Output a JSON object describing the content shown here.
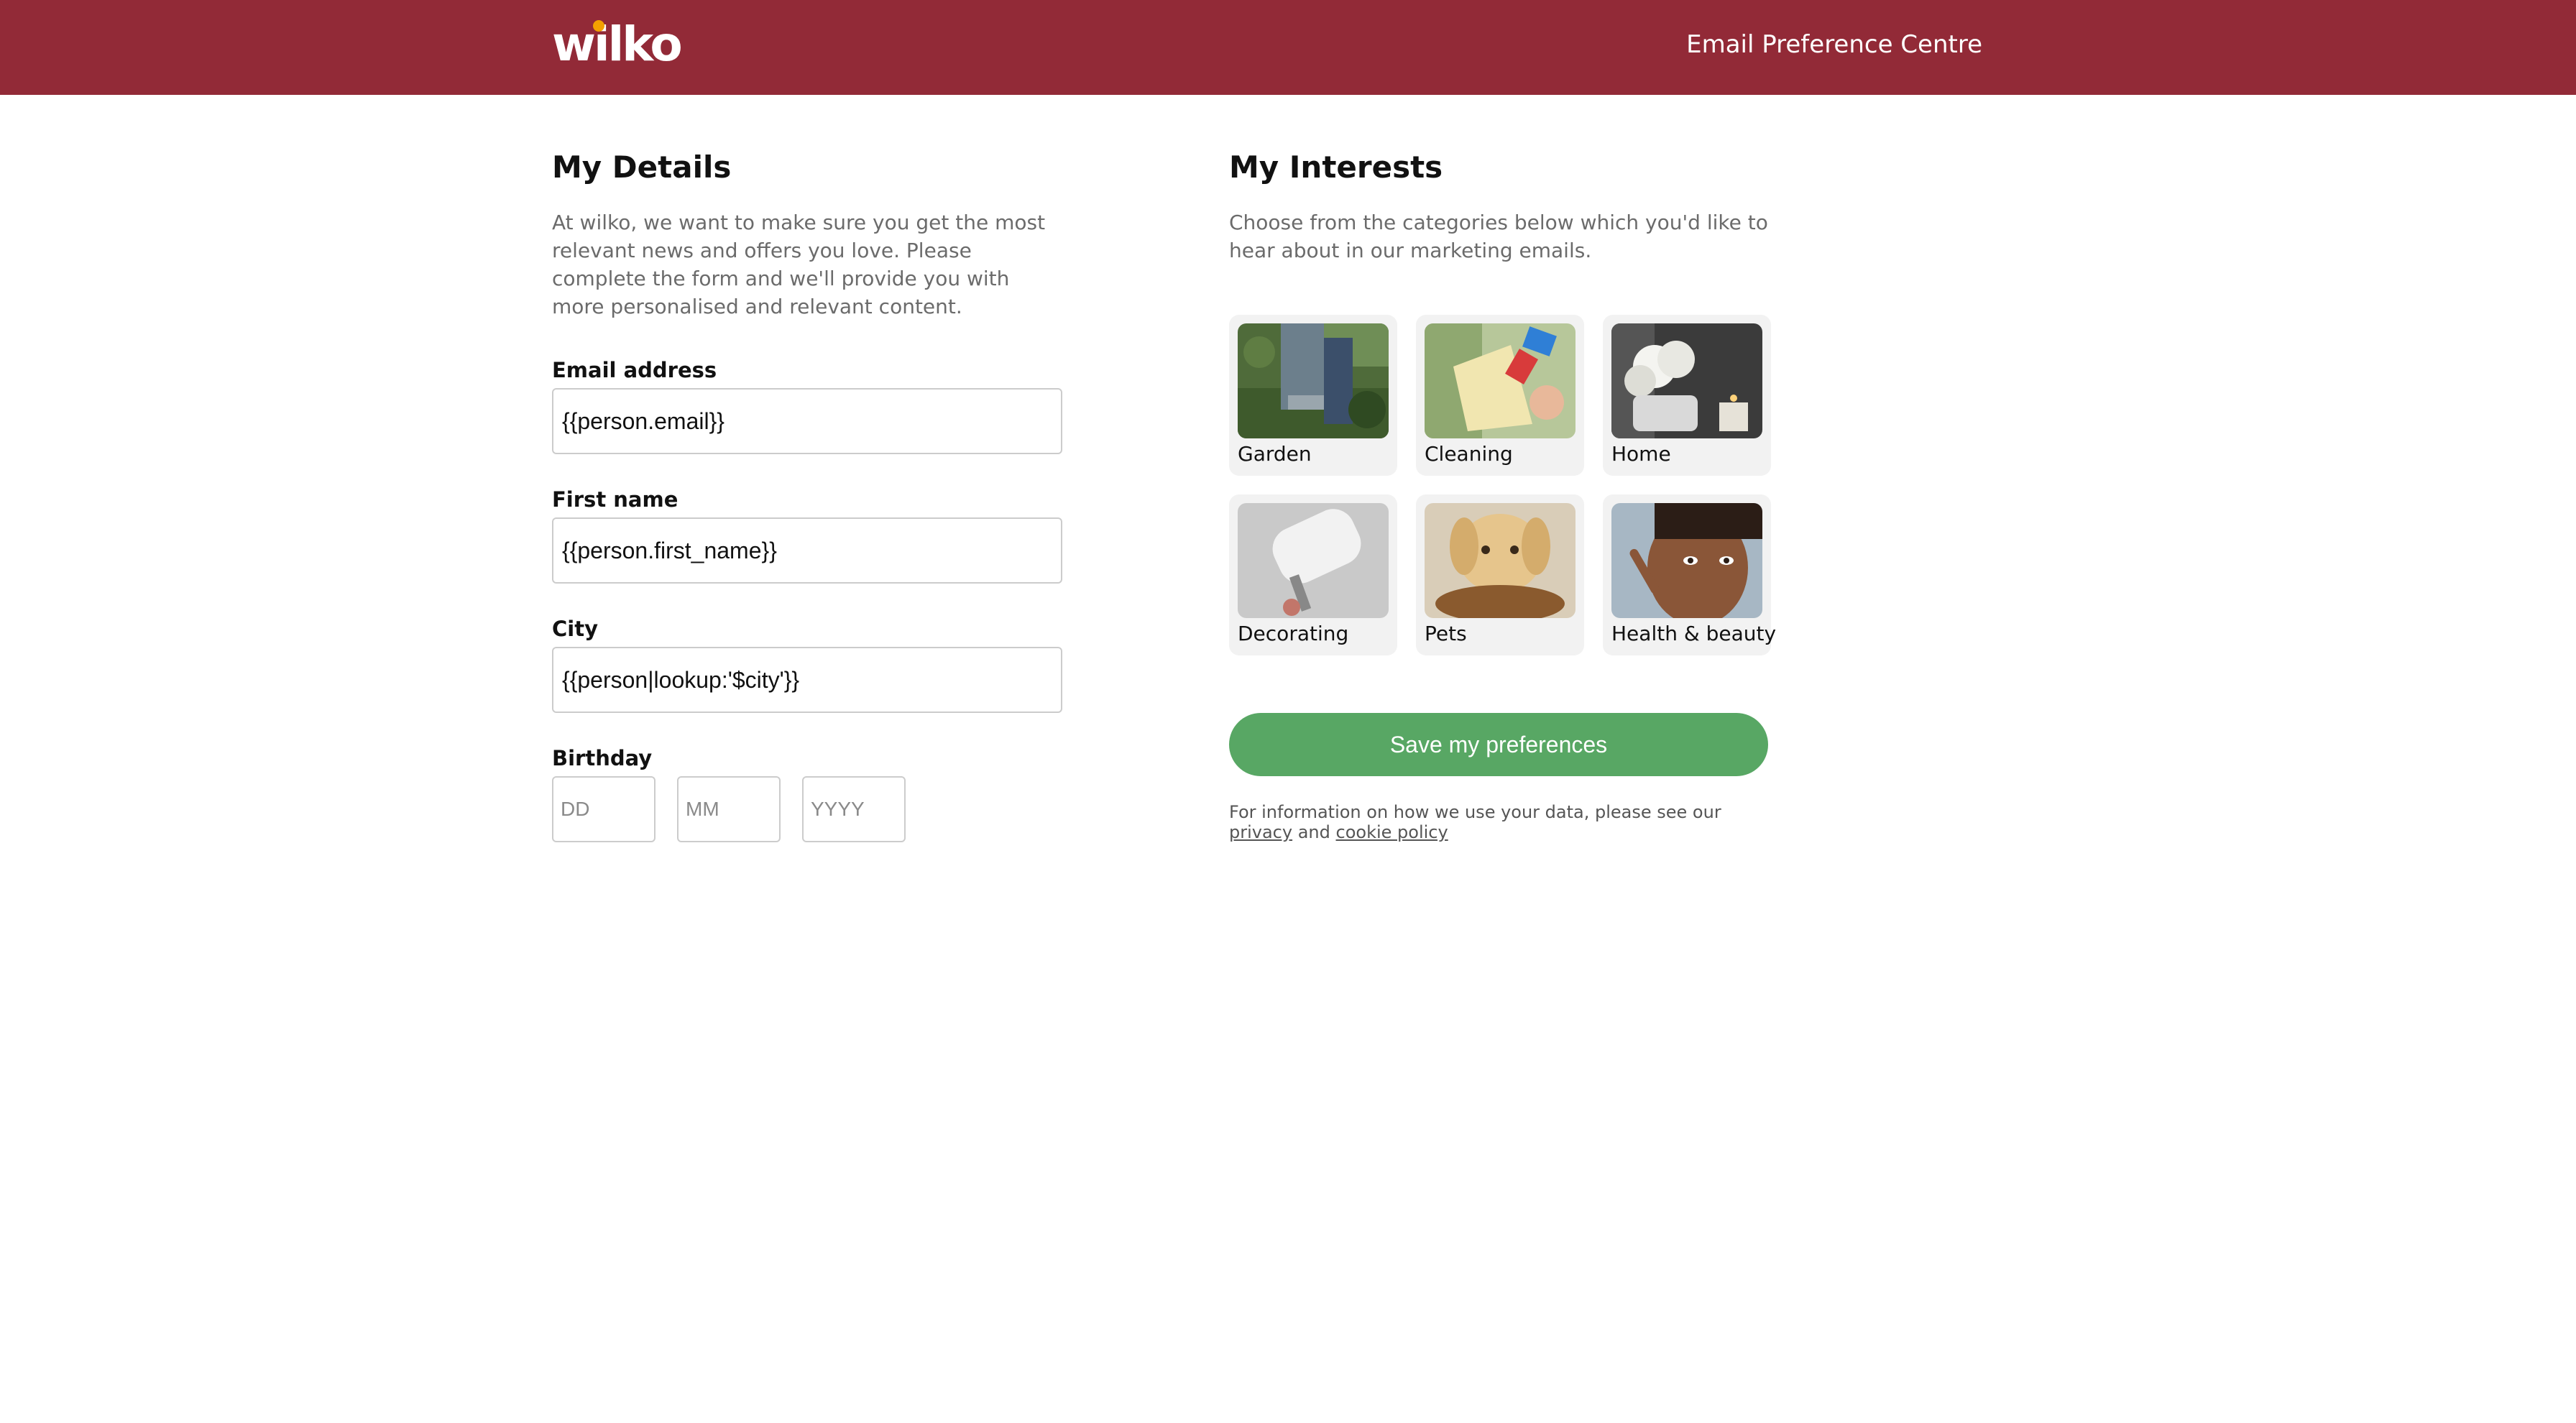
{
  "header": {
    "logo_text": "wilko",
    "title": "Email Preference Centre",
    "background": "#922a37"
  },
  "details": {
    "heading": "My Details",
    "intro": "At wilko, we want to make sure you get the most relevant news and offers you love. Please complete the form and we'll provide you with more personalised and relevant content.",
    "email_label": "Email address",
    "email_value": "{{person.email}}",
    "first_name_label": "First name",
    "first_name_value": "{{person.first_name}}",
    "city_label": "City",
    "city_value": "{{person|lookup:'$city'}}",
    "birthday_label": "Birthday",
    "birthday_day_placeholder": "DD",
    "birthday_month_placeholder": "MM",
    "birthday_year_placeholder": "YYYY"
  },
  "interests": {
    "heading": "My Interests",
    "intro": "Choose from the categories below which you'd like to hear about in our marketing emails.",
    "categories": [
      {
        "label": "Garden",
        "icon": "garden-image"
      },
      {
        "label": "Cleaning",
        "icon": "cleaning-image"
      },
      {
        "label": "Home",
        "icon": "home-image"
      },
      {
        "label": "Decorating",
        "icon": "decorating-image"
      },
      {
        "label": "Pets",
        "icon": "pets-image"
      },
      {
        "label": "Health & beauty",
        "icon": "health-beauty-image"
      }
    ],
    "save_label": "Save my preferences",
    "save_color": "#58a764",
    "footnote_prefix": "For information on how we use your data, please see our",
    "privacy_link": "privacy",
    "footnote_and": "and",
    "cookie_link": "cookie policy"
  }
}
